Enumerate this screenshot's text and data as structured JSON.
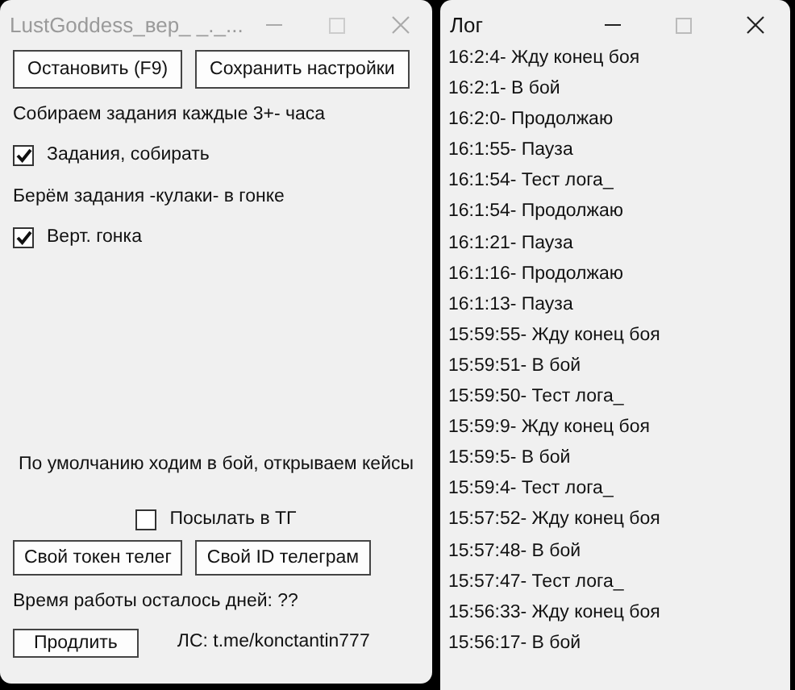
{
  "settings_window": {
    "title": "LustGoddess_вер_ _._...",
    "active": false,
    "top_buttons": [
      "Остановить (F9)",
      "Сохранить настройки"
    ],
    "options": [
      {
        "kind": "label",
        "text": "Собираем задания каждые 3+- часа"
      },
      {
        "kind": "checkbox",
        "text": "Задания, собирать",
        "checked": true
      },
      {
        "kind": "label",
        "text": "Берём задания -кулаки- в гонке"
      },
      {
        "kind": "checkbox",
        "text": "Верт. гонка",
        "checked": true
      }
    ],
    "footer": {
      "note": "По умолчанию ходим в бой, открываем кейсы",
      "telegram_checkbox": {
        "text": "Посылать в ТГ",
        "checked": false
      },
      "telegram_buttons": [
        "Свой токен телег",
        "Свой ID телеграм"
      ],
      "days_left": "Время работы осталось дней: ??",
      "extend_button": "Продлить",
      "contact": "ЛС: t.me/konctantin777"
    }
  },
  "log_window": {
    "title": "Лог",
    "active": true,
    "entries": [
      "16:2:4- Жду конец боя",
      "16:2:1- В бой",
      "16:2:0- Продолжаю",
      "16:1:55- Пауза",
      "16:1:54- Тест лога_",
      "16:1:54- Продолжаю",
      "16:1:21- Пауза",
      "16:1:16- Продолжаю",
      "16:1:13- Пауза",
      "15:59:55- Жду конец боя",
      "15:59:51- В бой",
      "15:59:50- Тест лога_",
      "15:59:9- Жду конец боя",
      "15:59:5- В бой",
      "15:59:4- Тест лога_",
      "15:57:52- Жду конец боя",
      "15:57:48- В бой",
      "15:57:47- Тест лога_",
      "15:56:33- Жду конец боя",
      "15:56:17- В бой"
    ]
  }
}
